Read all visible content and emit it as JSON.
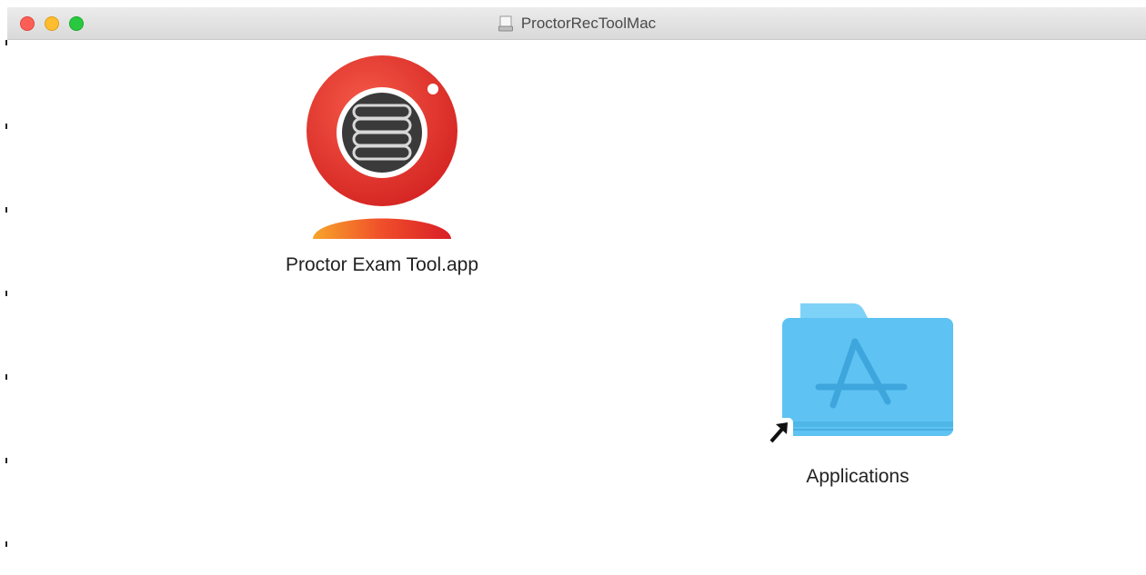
{
  "window": {
    "title": "ProctorRecToolMac",
    "title_icon": "disk-image-icon",
    "controls": [
      "close",
      "minimize",
      "zoom"
    ]
  },
  "items": [
    {
      "label": "Proctor Exam Tool.app",
      "icon": "proctor-app-icon"
    },
    {
      "label": "Applications",
      "icon": "applications-folder-alias-icon"
    }
  ],
  "colors": {
    "app_red": "#e8312f",
    "app_orange": "#f26a2a",
    "folder_blue": "#5ec3f2",
    "folder_tab_blue": "#7fd2f7"
  }
}
